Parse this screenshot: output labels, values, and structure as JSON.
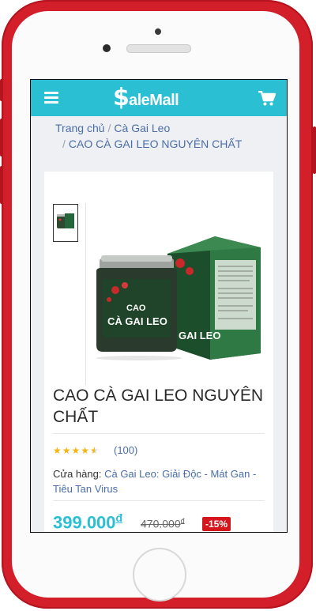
{
  "header": {
    "logo_symbol": "$",
    "logo_text": "aleMall",
    "menu_icon": "menu-icon",
    "cart_icon": "cart-icon",
    "brand_color": "#2bbfd4"
  },
  "breadcrumb": {
    "items": [
      "Trang chủ",
      "Cà Gai Leo",
      "CAO CÀ GAI LEO NGUYÊN CHẤT"
    ],
    "separator": "/"
  },
  "product": {
    "title": "CAO CÀ GAI LEO NGUYÊN CHẤT",
    "rating": 4.5,
    "rating_stars": "★★★★★",
    "review_count": "(100)",
    "store_label": "Cửa hàng:",
    "store_name": "Cà Gai Leo: Giải Độc - Mát Gan - Tiêu Tan Virus",
    "price": "399.000",
    "price_currency": "đ",
    "old_price": "470.000",
    "old_price_currency": "đ",
    "discount": "-15%",
    "jar_label_top": "CAO",
    "jar_label_main": "CÀ GAI LEO",
    "box_label": "GAI LEO",
    "discount_color": "#d5161c",
    "price_color": "#2bbfd4",
    "star_color": "#f6b40e"
  }
}
